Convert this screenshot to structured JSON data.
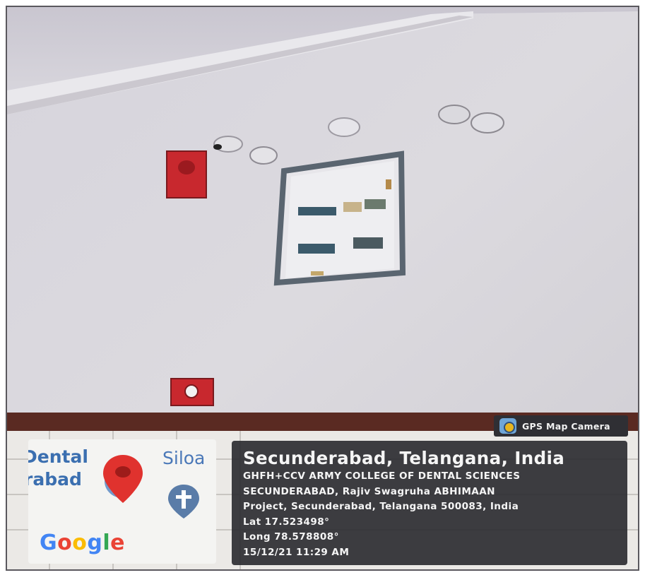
{
  "camera_tag": {
    "label": "GPS Map Camera",
    "icon": "camera-app-icon"
  },
  "map": {
    "labels": {
      "dental": "Dental",
      "abad": "rabad",
      "siloa": "Siloa"
    },
    "pin_icon": "location-pin-icon",
    "pin_color": "#e0322e",
    "church_icon": "church-cross-icon",
    "attribution": "Google"
  },
  "location": {
    "headline": "Secunderabad, Telangana, India",
    "address_line_1": "GHFH+CCV ARMY COLLEGE OF DENTAL SCIENCES",
    "address_line_2": "SECUNDERABAD, Rajiv Swagruha ABHIMAAN",
    "address_line_3": "Project, Secunderabad, Telangana 500083, India",
    "latitude": "Lat 17.523498°",
    "longitude": "Long 78.578808°",
    "timestamp": "15/12/21 11:29 AM"
  },
  "scene": {
    "description_objects": [
      "fire-alarm-bell",
      "smoke-detector",
      "electrical-distribution-panel",
      "manual-call-point"
    ],
    "wall_color": "#d9d7dd",
    "alarm_color": "#c8282e",
    "skirting_color": "#5a2a22"
  }
}
